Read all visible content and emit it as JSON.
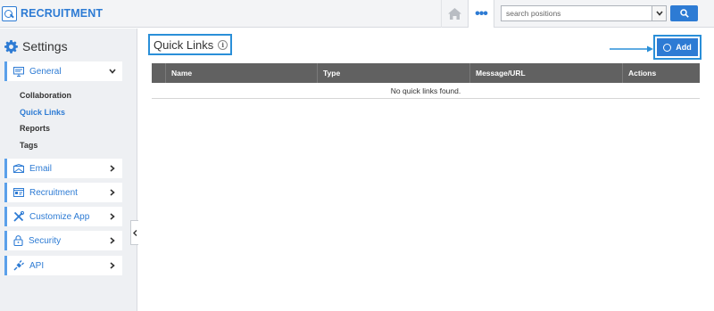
{
  "app": {
    "title": "RECRUITMENT"
  },
  "header": {
    "search_placeholder": "search positions",
    "more_label": "•••"
  },
  "sidebar": {
    "title": "Settings",
    "general": {
      "label": "General"
    },
    "sub_items": [
      {
        "label": "Collaboration"
      },
      {
        "label": "Quick Links"
      },
      {
        "label": "Reports"
      },
      {
        "label": "Tags"
      }
    ],
    "sections": [
      {
        "label": "Email"
      },
      {
        "label": "Recruitment"
      },
      {
        "label": "Customize App"
      },
      {
        "label": "Security"
      },
      {
        "label": "API"
      }
    ]
  },
  "main": {
    "title": "Quick Links",
    "info_symbol": "i",
    "add_label": "Add",
    "table": {
      "columns": [
        "",
        "Name",
        "Type",
        "Message/URL",
        "Actions"
      ],
      "empty_message": "No quick links found."
    }
  },
  "colors": {
    "accent": "#2d7bd4",
    "highlight_border": "#2a8fd8",
    "table_header": "#616161",
    "sidebar_bg": "#eef0f3"
  }
}
